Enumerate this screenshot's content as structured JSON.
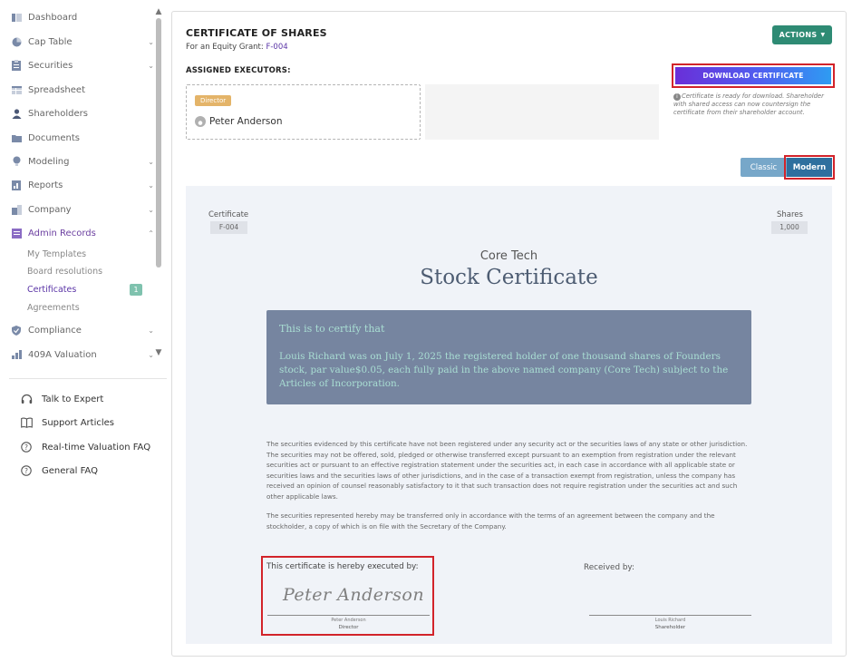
{
  "sidebar": {
    "items": [
      {
        "label": "Dashboard",
        "icon": "dashboard-icon"
      },
      {
        "label": "Cap Table",
        "icon": "pie-chart-icon",
        "chevron": "chevron-down"
      },
      {
        "label": "Securities",
        "icon": "clipboard-icon",
        "chevron": "chevron-down"
      },
      {
        "label": "Spreadsheet",
        "icon": "spreadsheet-icon"
      },
      {
        "label": "Shareholders",
        "icon": "user-icon"
      },
      {
        "label": "Documents",
        "icon": "folder-icon"
      },
      {
        "label": "Modeling",
        "icon": "lightbulb-icon",
        "chevron": "chevron-down"
      },
      {
        "label": "Reports",
        "icon": "report-icon",
        "chevron": "chevron-down"
      },
      {
        "label": "Company",
        "icon": "building-icon",
        "chevron": "chevron-down"
      },
      {
        "label": "Admin Records",
        "icon": "records-icon",
        "chevron": "chevron-up"
      },
      {
        "label": "Compliance",
        "icon": "shield-check-icon",
        "chevron": "chevron-down"
      },
      {
        "label": "409A Valuation",
        "icon": "bar-chart-icon",
        "chevron": "chevron-down"
      }
    ],
    "admin_sub": [
      {
        "label": "My Templates"
      },
      {
        "label": "Board resolutions"
      },
      {
        "label": "Certificates",
        "badge": "1"
      },
      {
        "label": "Agreements"
      }
    ],
    "help": [
      {
        "label": "Talk to Expert",
        "icon": "headset-icon"
      },
      {
        "label": "Support Articles",
        "icon": "book-icon"
      },
      {
        "label": "Real-time Valuation FAQ",
        "icon": "question-circle-icon"
      },
      {
        "label": "General FAQ",
        "icon": "question-circle-icon"
      }
    ]
  },
  "header": {
    "title": "CERTIFICATE OF SHARES",
    "subtitle_prefix": "For an Equity Grant:",
    "grant_id": "F-004",
    "actions_label": "ACTIONS"
  },
  "executors": {
    "label": "ASSIGNED EXECUTORS:",
    "role": "Director",
    "name": "Peter Anderson"
  },
  "download": {
    "label": "DOWNLOAD CERTIFICATE",
    "note": "Certificate is ready for download. Shareholder with shared access can now countersign the certificate from their shareholder account."
  },
  "view_toggle": {
    "classic": "Classic",
    "modern": "Modern",
    "selected": "Modern"
  },
  "certificate": {
    "cert_label": "Certificate",
    "cert_number": "F-004",
    "shares_label": "Shares",
    "shares_value": "1,000",
    "company": "Core Tech",
    "title": "Stock Certificate",
    "intro": "This is to certify that",
    "body": "Louis Richard was on July 1, 2025 the registered holder of one thousand shares of Founders stock, par value$0.05, each fully paid in the above named company (Core Tech) subject to the Articles of Incorporation.",
    "legal_1": "The securities evidenced by this certificate have not been registered under any security act or the securities laws of any state or other jurisdiction. The securities may not be offered, sold, pledged or otherwise transferred except pursuant to an exemption from registration under the relevant securities act or pursuant to an effective registration statement under the securities act, in each case in accordance with all applicable state or securities laws and the securities laws of other jurisdictions, and in the case of a transaction exempt from registration, unless the company has received an opinion of counsel reasonably satisfactory to it that such transaction does not require registration under the securities act and such other applicable laws.",
    "legal_2": "The securities represented hereby may be transferred only in accordance with the terms of an agreement between the company and the stockholder, a copy of which is on file with the Secretary of the Company.",
    "executed_by_label": "This certificate is hereby executed by:",
    "signature": "Peter Anderson",
    "executor_name": "Peter Anderson",
    "executor_role": "Director",
    "received_by_label": "Received by:",
    "receiver_name": "Louis Richard",
    "receiver_role": "Shareholder"
  },
  "colors": {
    "accent_purple": "#5a34a6",
    "actions_green": "#2e8b74",
    "highlight_red": "#d2232a",
    "cert_body_bg": "#7685a0",
    "cert_body_text": "#a9ded3"
  }
}
